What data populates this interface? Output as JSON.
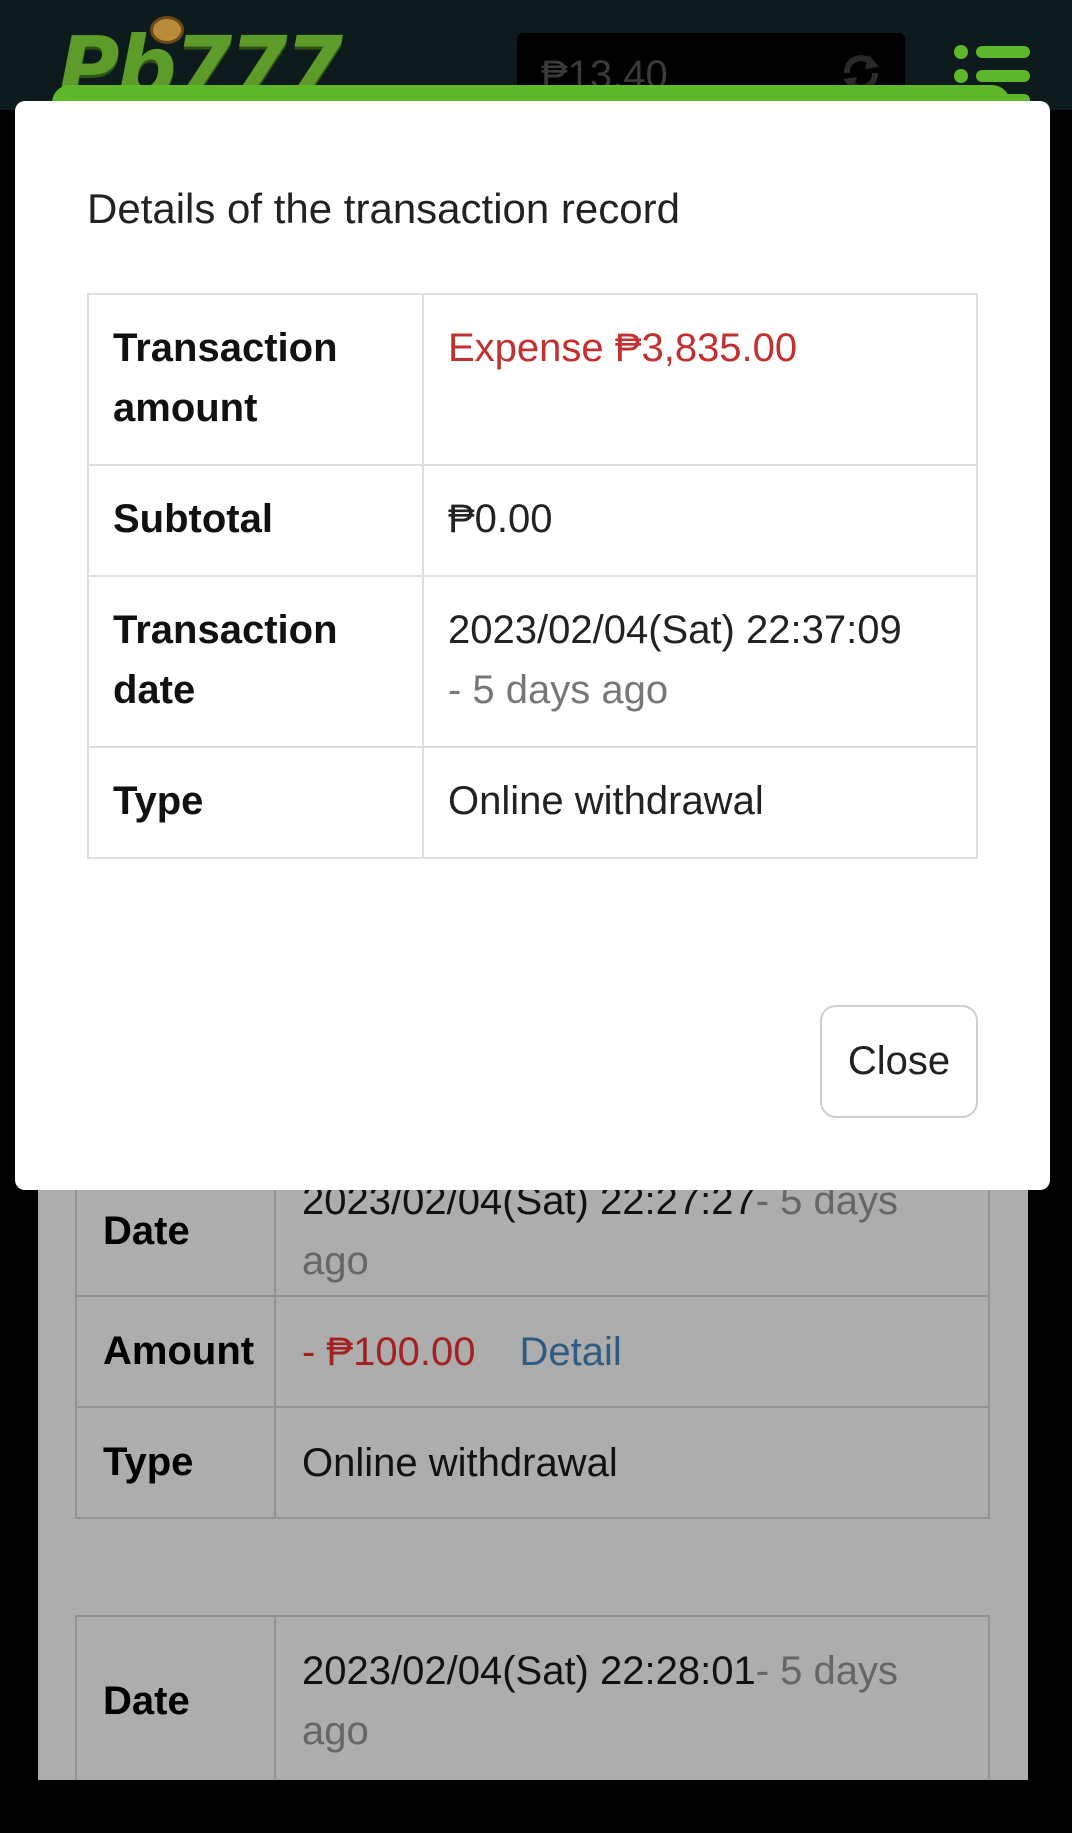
{
  "header": {
    "logo_text": "Pb777",
    "balance": "₱13.40"
  },
  "modal": {
    "title": "Details of the transaction record",
    "rows": [
      {
        "label": "Transaction amount",
        "value": "Expense ₱3,835.00"
      },
      {
        "label": "Subtotal",
        "value": "₱0.00"
      },
      {
        "label": "Transaction date",
        "value": "2023/02/04(Sat) 22:37:09",
        "note": "- 5 days ago"
      },
      {
        "label": "Type",
        "value": "Online withdrawal"
      }
    ],
    "close_label": "Close"
  },
  "background": {
    "record1": {
      "date_label": "Date",
      "date_value": "2023/02/04(Sat) 22:27:27",
      "date_note": "- 5 days ago",
      "amount_label": "Amount",
      "amount_value": "- ₱100.00",
      "detail_link": "Detail",
      "type_label": "Type",
      "type_value": "Online withdrawal"
    },
    "record2": {
      "date_label": "Date",
      "date_value": "2023/02/04(Sat) 22:28:01",
      "date_note": "- 5 days ago"
    }
  },
  "colors": {
    "expense_red": "#c33030",
    "link_blue": "#2f5a82",
    "brand_green": "#5fb82a"
  }
}
